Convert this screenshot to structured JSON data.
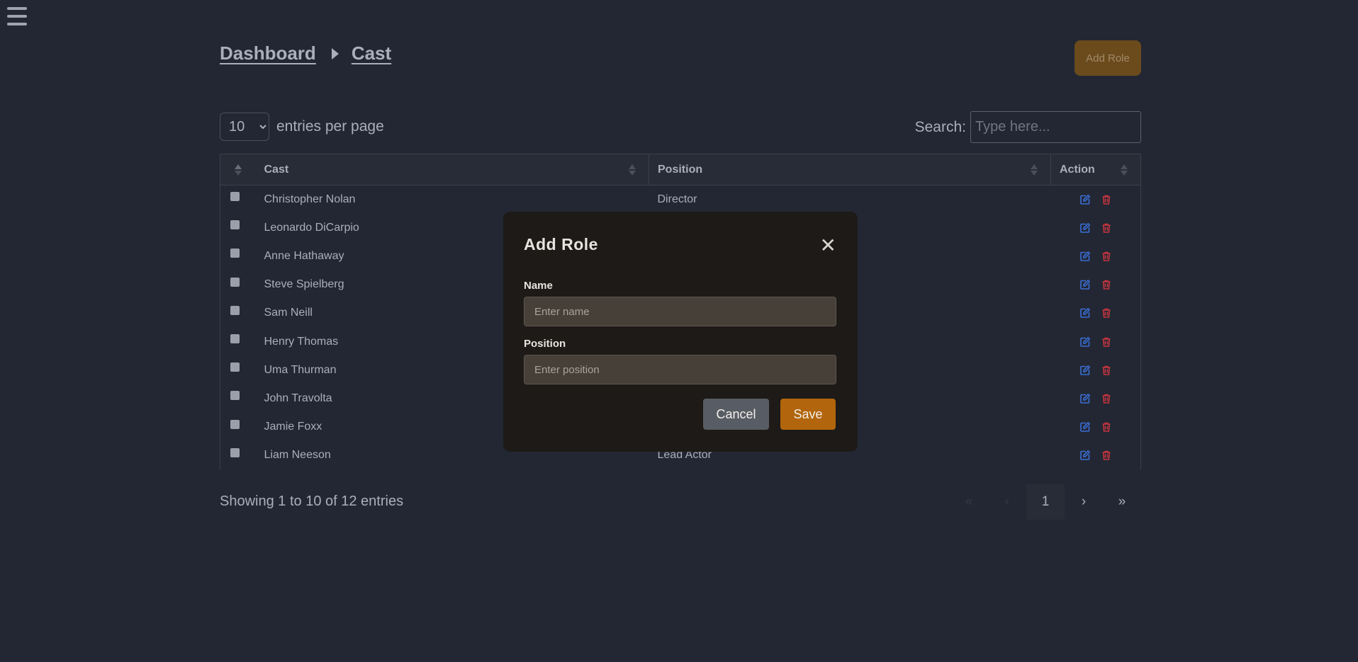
{
  "nav": {
    "menu_icon": "hamburger-icon"
  },
  "breadcrumb": {
    "items": [
      "Dashboard",
      "Cast"
    ]
  },
  "header": {
    "add_role_label": "Add Role"
  },
  "controls": {
    "entries_value": "10",
    "entries_options": [
      "10"
    ],
    "entries_label": "entries per page",
    "search_label": "Search:",
    "search_placeholder": "Type here..."
  },
  "table": {
    "columns": [
      "Cast",
      "Position",
      "Action"
    ],
    "rows": [
      {
        "cast": "Christopher Nolan",
        "position": "Director"
      },
      {
        "cast": "Leonardo DiCarpio",
        "position": ""
      },
      {
        "cast": "Anne Hathaway",
        "position": ""
      },
      {
        "cast": "Steve Spielberg",
        "position": ""
      },
      {
        "cast": "Sam Neill",
        "position": ""
      },
      {
        "cast": "Henry Thomas",
        "position": ""
      },
      {
        "cast": "Uma Thurman",
        "position": ""
      },
      {
        "cast": "John Travolta",
        "position": ""
      },
      {
        "cast": "Jamie Foxx",
        "position": ""
      },
      {
        "cast": "Liam Neeson",
        "position": "Lead Actor"
      }
    ],
    "action_icons": [
      "edit-icon",
      "trash-icon"
    ]
  },
  "footer": {
    "info": "Showing 1 to 10 of 12 entries",
    "pager": {
      "first": "«",
      "prev": "‹",
      "current": "1",
      "next": "›",
      "last": "»"
    }
  },
  "modal": {
    "title": "Add Role",
    "close_glyph": "✕",
    "name_label": "Name",
    "name_placeholder": "Enter name",
    "position_label": "Position",
    "position_placeholder": "Enter position",
    "cancel_label": "Cancel",
    "save_label": "Save"
  },
  "colors": {
    "background": "#222733",
    "accent": "#b2650c",
    "edit_icon": "#3b6fd6",
    "delete_icon": "#c4353f"
  }
}
